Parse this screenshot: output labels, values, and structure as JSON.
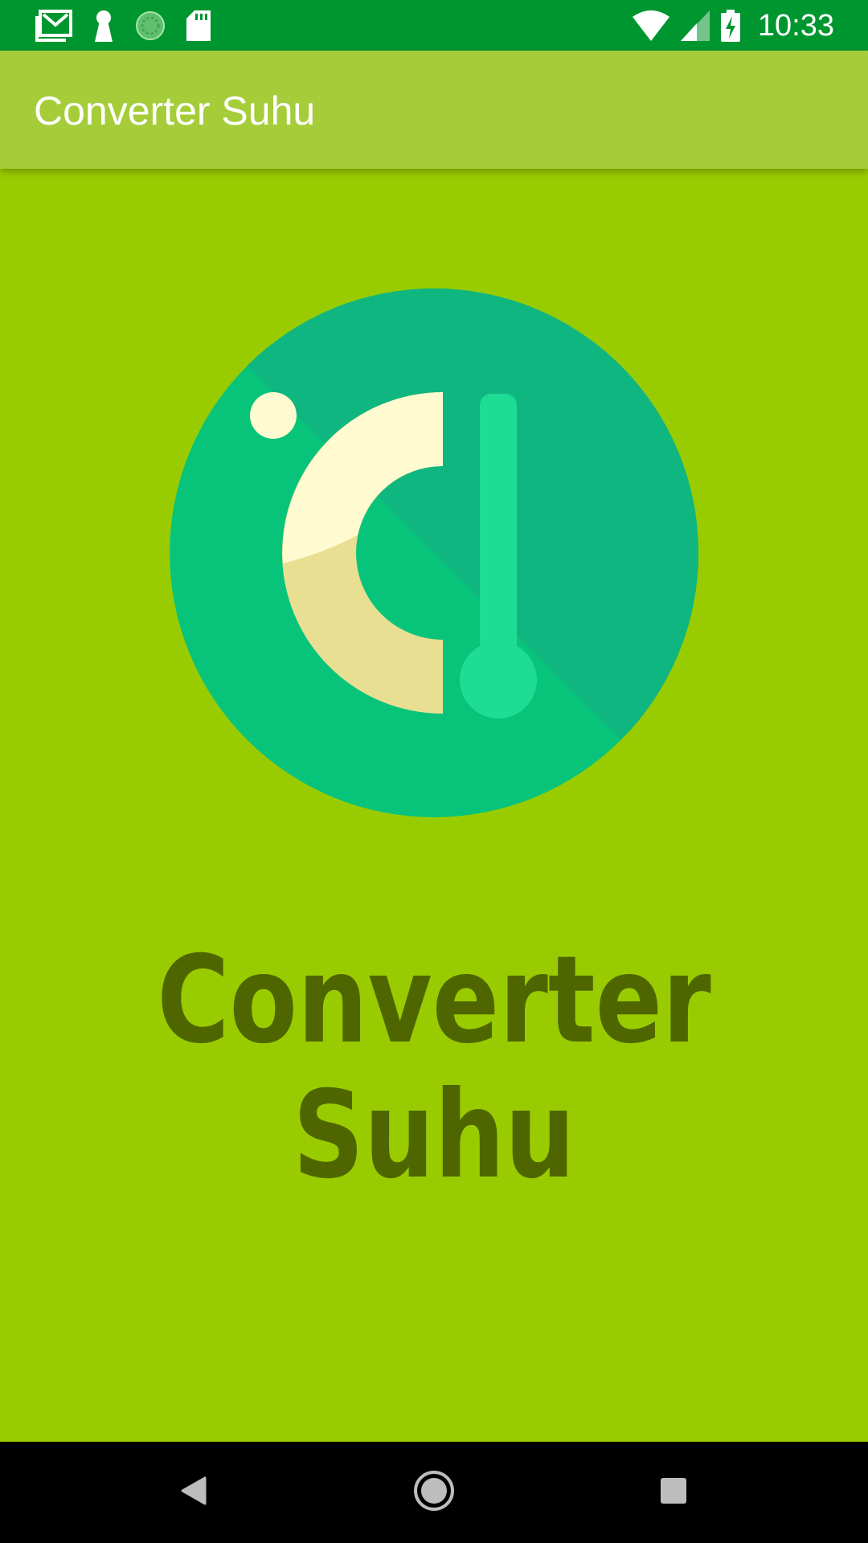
{
  "status_bar": {
    "time": "10:33",
    "left_icons": [
      "gmail-icon",
      "keyhole-icon",
      "sync-progress-icon",
      "sd-card-icon"
    ],
    "right_icons": [
      "wifi-icon",
      "signal-icon",
      "battery-charging-icon"
    ]
  },
  "app_bar": {
    "title": "Converter Suhu"
  },
  "main": {
    "logo_icon": "thermometer-logo-icon",
    "title_line1": "Converter",
    "title_line2": "Suhu"
  },
  "nav_bar": {
    "buttons": [
      "back-icon",
      "home-icon",
      "recents-icon"
    ]
  },
  "colors": {
    "status_bar": "#00962f",
    "app_bar": "#a5cd39",
    "background": "#99cc00",
    "title_text": "#4f6600",
    "logo_circle_dark": "#10b67f",
    "logo_circle_light": "#08c47a",
    "thermometer": "#1ddc94",
    "arc_light": "#fffacf",
    "arc_dark": "#e8df93"
  }
}
